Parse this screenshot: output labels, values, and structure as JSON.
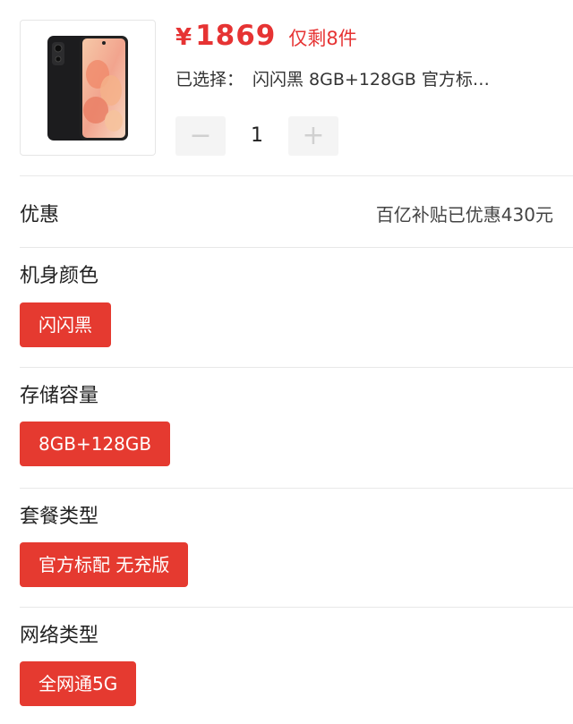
{
  "product": {
    "currency_symbol": "¥",
    "price": "1869",
    "stock_note": "仅剩8件",
    "selected_label": "已选择：",
    "selected_value": "闪闪黑 8GB+128GB 官方标…",
    "quantity": "1",
    "decrease_symbol": "−",
    "increase_symbol": "+",
    "image_icon": "black-smartphone-image"
  },
  "promo": {
    "label": "优惠",
    "value": "百亿补贴已优惠430元"
  },
  "options": [
    {
      "title": "机身颜色",
      "selected": "闪闪黑"
    },
    {
      "title": "存储容量",
      "selected": "8GB+128GB"
    },
    {
      "title": "套餐类型",
      "selected": "官方标配 无充版"
    },
    {
      "title": "网络类型",
      "selected": "全网通5G"
    }
  ],
  "colors": {
    "accent": "#e53a30",
    "price": "#e63333",
    "divider": "#e8e8e8",
    "stepper_bg": "#f4f4f4"
  }
}
